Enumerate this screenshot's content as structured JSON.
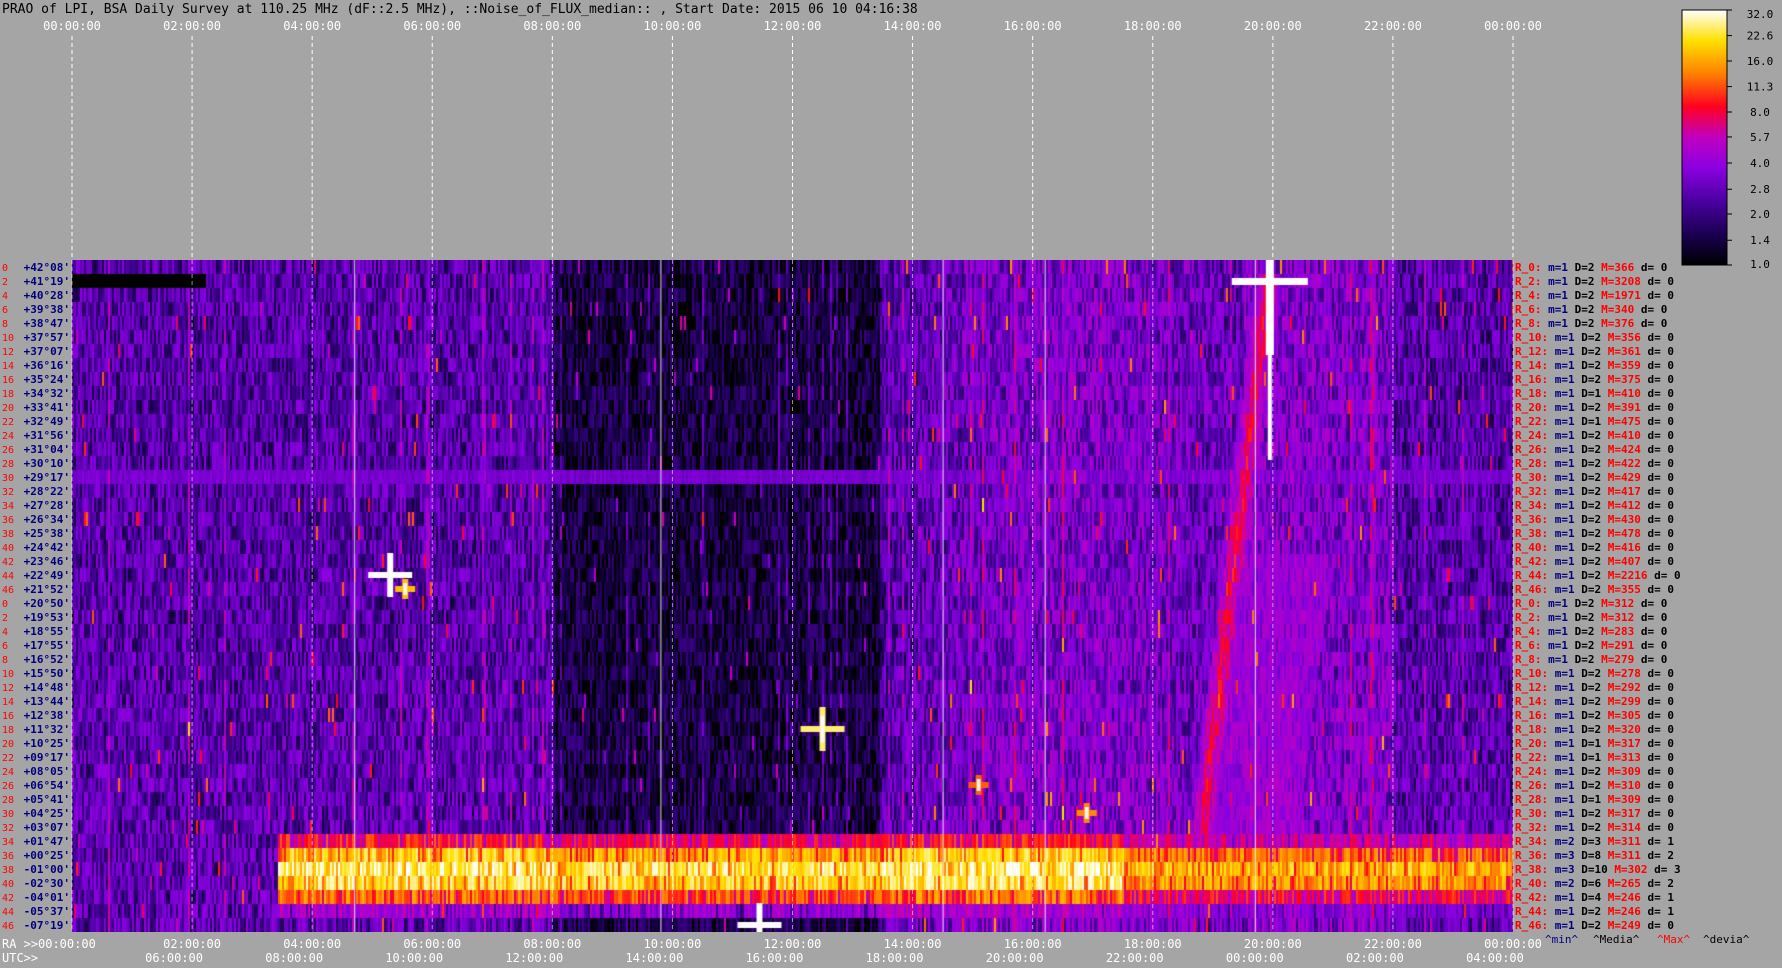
{
  "chart_data": {
    "type": "heatmap",
    "title": "PRAO of LPI, BSA Daily Survey at 110.25 MHz (dF::2.5 MHz), ::Noise_of_FLUX_median:: , Start Date: 2015 06 10 04:16:38",
    "top_ticks": [
      "00:00:00",
      "02:00:00",
      "04:00:00",
      "06:00:00",
      "08:00:00",
      "10:00:00",
      "12:00:00",
      "14:00:00",
      "16:00:00",
      "18:00:00",
      "20:00:00",
      "22:00:00",
      "00:00:00"
    ],
    "ra_axis": {
      "prefix": "RA >>",
      "ticks": [
        "00:00:00",
        "02:00:00",
        "04:00:00",
        "06:00:00",
        "08:00:00",
        "10:00:00",
        "12:00:00",
        "14:00:00",
        "16:00:00",
        "18:00:00",
        "20:00:00",
        "22:00:00",
        "00:00:00"
      ]
    },
    "utc_axis": {
      "prefix": "UTC>>",
      "ticks": [
        "06:00:00",
        "08:00:00",
        "10:00:00",
        "12:00:00",
        "14:00:00",
        "16:00:00",
        "18:00:00",
        "20:00:00",
        "22:00:00",
        "00:00:00",
        "02:00:00",
        "04:00:00"
      ]
    },
    "declinations": [
      "+42°08'",
      "+41°19'",
      "+40°28'",
      "+39°38'",
      "+38°47'",
      "+37°57'",
      "+37°07'",
      "+36°16'",
      "+35°24'",
      "+34°32'",
      "+33°41'",
      "+32°49'",
      "+31°56'",
      "+31°04'",
      "+30°10'",
      "+29°17'",
      "+28°22'",
      "+27°28'",
      "+26°34'",
      "+25°38'",
      "+24°42'",
      "+23°46'",
      "+22°49'",
      "+21°52'",
      "+20°50'",
      "+19°53'",
      "+18°55'",
      "+17°55'",
      "+16°52'",
      "+15°50'",
      "+14°48'",
      "+13°44'",
      "+12°38'",
      "+11°32'",
      "+10°25'",
      "+09°17'",
      "+08°05'",
      "+06°54'",
      "+05°41'",
      "+04°25'",
      "+03°07'",
      "+01°47'",
      "+00°25'",
      "-01°00'",
      "-02°30'",
      "-04°01'",
      "-05°37'",
      "-07°19'"
    ],
    "row_numbers": [
      "0",
      "2",
      "4",
      "6",
      "8",
      "10",
      "12",
      "14",
      "16",
      "18",
      "20",
      "22",
      "24",
      "26",
      "28",
      "30",
      "32",
      "34",
      "36",
      "38",
      "40",
      "42",
      "44",
      "46",
      "0",
      "2",
      "4",
      "6",
      "8",
      "10",
      "12",
      "14",
      "16",
      "18",
      "20",
      "22",
      "24",
      "26",
      "28",
      "30",
      "32",
      "34",
      "36",
      "38",
      "40",
      "42",
      "44",
      "46"
    ],
    "row_stats": [
      {
        "r": "R_0:",
        "m": "m=1",
        "D": "D=2",
        "M": "M=366",
        "d": "d= 0"
      },
      {
        "r": "R_2:",
        "m": "m=1",
        "D": "D=2",
        "M": "M=3208",
        "d": "d= 0"
      },
      {
        "r": "R_4:",
        "m": "m=1",
        "D": "D=2",
        "M": "M=1971",
        "d": "d= 0"
      },
      {
        "r": "R_6:",
        "m": "m=1",
        "D": "D=2",
        "M": "M=340",
        "d": "d= 0"
      },
      {
        "r": "R_8:",
        "m": "m=1",
        "D": "D=2",
        "M": "M=376",
        "d": "d= 0"
      },
      {
        "r": "R_10:",
        "m": "m=1",
        "D": "D=2",
        "M": "M=356",
        "d": "d= 0"
      },
      {
        "r": "R_12:",
        "m": "m=1",
        "D": "D=2",
        "M": "M=361",
        "d": "d= 0"
      },
      {
        "r": "R_14:",
        "m": "m=1",
        "D": "D=2",
        "M": "M=359",
        "d": "d= 0"
      },
      {
        "r": "R_16:",
        "m": "m=1",
        "D": "D=2",
        "M": "M=375",
        "d": "d= 0"
      },
      {
        "r": "R_18:",
        "m": "m=1",
        "D": "D=1",
        "M": "M=410",
        "d": "d= 0"
      },
      {
        "r": "R_20:",
        "m": "m=1",
        "D": "D=2",
        "M": "M=391",
        "d": "d= 0"
      },
      {
        "r": "R_22:",
        "m": "m=1",
        "D": "D=1",
        "M": "M=475",
        "d": "d= 0"
      },
      {
        "r": "R_24:",
        "m": "m=1",
        "D": "D=2",
        "M": "M=410",
        "d": "d= 0"
      },
      {
        "r": "R_26:",
        "m": "m=1",
        "D": "D=2",
        "M": "M=424",
        "d": "d= 0"
      },
      {
        "r": "R_28:",
        "m": "m=1",
        "D": "D=2",
        "M": "M=422",
        "d": "d= 0"
      },
      {
        "r": "R_30:",
        "m": "m=1",
        "D": "D=2",
        "M": "M=429",
        "d": "d= 0"
      },
      {
        "r": "R_32:",
        "m": "m=1",
        "D": "D=2",
        "M": "M=417",
        "d": "d= 0"
      },
      {
        "r": "R_34:",
        "m": "m=1",
        "D": "D=2",
        "M": "M=412",
        "d": "d= 0"
      },
      {
        "r": "R_36:",
        "m": "m=1",
        "D": "D=2",
        "M": "M=430",
        "d": "d= 0"
      },
      {
        "r": "R_38:",
        "m": "m=1",
        "D": "D=2",
        "M": "M=478",
        "d": "d= 0"
      },
      {
        "r": "R_40:",
        "m": "m=1",
        "D": "D=2",
        "M": "M=416",
        "d": "d= 0"
      },
      {
        "r": "R_42:",
        "m": "m=1",
        "D": "D=2",
        "M": "M=407",
        "d": "d= 0"
      },
      {
        "r": "R_44:",
        "m": "m=1",
        "D": "D=2",
        "M": "M=2216",
        "d": "d= 0"
      },
      {
        "r": "R_46:",
        "m": "m=1",
        "D": "D=2",
        "M": "M=355",
        "d": "d= 0"
      },
      {
        "r": "R_0:",
        "m": "m=1",
        "D": "D=2",
        "M": "M=312",
        "d": "d= 0"
      },
      {
        "r": "R_2:",
        "m": "m=1",
        "D": "D=2",
        "M": "M=312",
        "d": "d= 0"
      },
      {
        "r": "R_4:",
        "m": "m=1",
        "D": "D=2",
        "M": "M=283",
        "d": "d= 0"
      },
      {
        "r": "R_6:",
        "m": "m=1",
        "D": "D=2",
        "M": "M=291",
        "d": "d= 0"
      },
      {
        "r": "R_8:",
        "m": "m=1",
        "D": "D=2",
        "M": "M=279",
        "d": "d= 0"
      },
      {
        "r": "R_10:",
        "m": "m=1",
        "D": "D=2",
        "M": "M=278",
        "d": "d= 0"
      },
      {
        "r": "R_12:",
        "m": "m=1",
        "D": "D=2",
        "M": "M=292",
        "d": "d= 0"
      },
      {
        "r": "R_14:",
        "m": "m=1",
        "D": "D=2",
        "M": "M=299",
        "d": "d= 0"
      },
      {
        "r": "R_16:",
        "m": "m=1",
        "D": "D=2",
        "M": "M=305",
        "d": "d= 0"
      },
      {
        "r": "R_18:",
        "m": "m=1",
        "D": "D=2",
        "M": "M=320",
        "d": "d= 0"
      },
      {
        "r": "R_20:",
        "m": "m=1",
        "D": "D=1",
        "M": "M=317",
        "d": "d= 0"
      },
      {
        "r": "R_22:",
        "m": "m=1",
        "D": "D=1",
        "M": "M=313",
        "d": "d= 0"
      },
      {
        "r": "R_24:",
        "m": "m=1",
        "D": "D=2",
        "M": "M=309",
        "d": "d= 0"
      },
      {
        "r": "R_26:",
        "m": "m=1",
        "D": "D=2",
        "M": "M=310",
        "d": "d= 0"
      },
      {
        "r": "R_28:",
        "m": "m=1",
        "D": "D=1",
        "M": "M=309",
        "d": "d= 0"
      },
      {
        "r": "R_30:",
        "m": "m=1",
        "D": "D=2",
        "M": "M=317",
        "d": "d= 0"
      },
      {
        "r": "R_32:",
        "m": "m=1",
        "D": "D=2",
        "M": "M=314",
        "d": "d= 0"
      },
      {
        "r": "R_34:",
        "m": "m=2",
        "D": "D=3",
        "M": "M=311",
        "d": "d= 1"
      },
      {
        "r": "R_36:",
        "m": "m=3",
        "D": "D=8",
        "M": "M=311",
        "d": "d= 2"
      },
      {
        "r": "R_38:",
        "m": "m=3",
        "D": "D=10",
        "M": "M=302",
        "d": "d= 3"
      },
      {
        "r": "R_40:",
        "m": "m=2",
        "D": "D=6",
        "M": "M=265",
        "d": "d= 2"
      },
      {
        "r": "R_42:",
        "m": "m=1",
        "D": "D=4",
        "M": "M=246",
        "d": "d= 1"
      },
      {
        "r": "R_44:",
        "m": "m=1",
        "D": "D=2",
        "M": "M=246",
        "d": "d= 1"
      },
      {
        "r": "R_46:",
        "m": "m=1",
        "D": "D=2",
        "M": "M=249",
        "d": "d= 0"
      }
    ],
    "stats_legend": [
      "^min^",
      "^Media^",
      "^Max^",
      "^devia^"
    ],
    "colorbar": {
      "ticks": [
        "32.0",
        "22.6",
        "16.0",
        "11.3",
        "8.0",
        "5.7",
        "4.0",
        "2.8",
        "2.0",
        "1.4",
        "1.0"
      ],
      "scale": "log",
      "range": [
        1.0,
        32.0
      ]
    },
    "colors": {
      "background": "#a5a5a5",
      "header_text": "#000000",
      "tick_text": "#ffffff",
      "declination_text": "#000080",
      "row_number_text": "#ff0000",
      "stat_label": "#ff0000",
      "stat_min": "#000080",
      "stat_max": "#ff0000",
      "stat_other": "#000000"
    },
    "colormap": [
      "#000000",
      "#1a0050",
      "#4a00a0",
      "#8a00e0",
      "#c000c0",
      "#ff0020",
      "#ff8000",
      "#ffe000",
      "#ffffff"
    ],
    "features": {
      "base_level": 2.6,
      "hot_band": {
        "rows_from": 41,
        "rows_to": 47,
        "ra_from_hours": 3.4,
        "ra_to_hours": 24.0,
        "peak_value": 30
      },
      "strong_source": {
        "ra_hours": 19.95,
        "dec_row": 1,
        "value": 32
      },
      "drifting_trail": {
        "ra_start_hours": 19.9,
        "row_start": 1,
        "ra_end_hours": 18.8,
        "row_end": 40,
        "value": 8
      },
      "point_sources": [
        {
          "ra_hours": 5.3,
          "row": 22,
          "value": 32
        },
        {
          "ra_hours": 5.55,
          "row": 23,
          "value": 18
        },
        {
          "ra_hours": 12.5,
          "row": 33,
          "value": 25
        },
        {
          "ra_hours": 11.45,
          "row": 47,
          "value": 32
        },
        {
          "ra_hours": 15.1,
          "row": 37,
          "value": 12
        },
        {
          "ra_hours": 16.9,
          "row": 39,
          "value": 14
        }
      ],
      "interference_row": {
        "row": 15,
        "value": 3.2
      },
      "blank_stripe": {
        "ra_from_hours": 0.0,
        "ra_to_hours": 2.2,
        "row": 1
      }
    }
  }
}
